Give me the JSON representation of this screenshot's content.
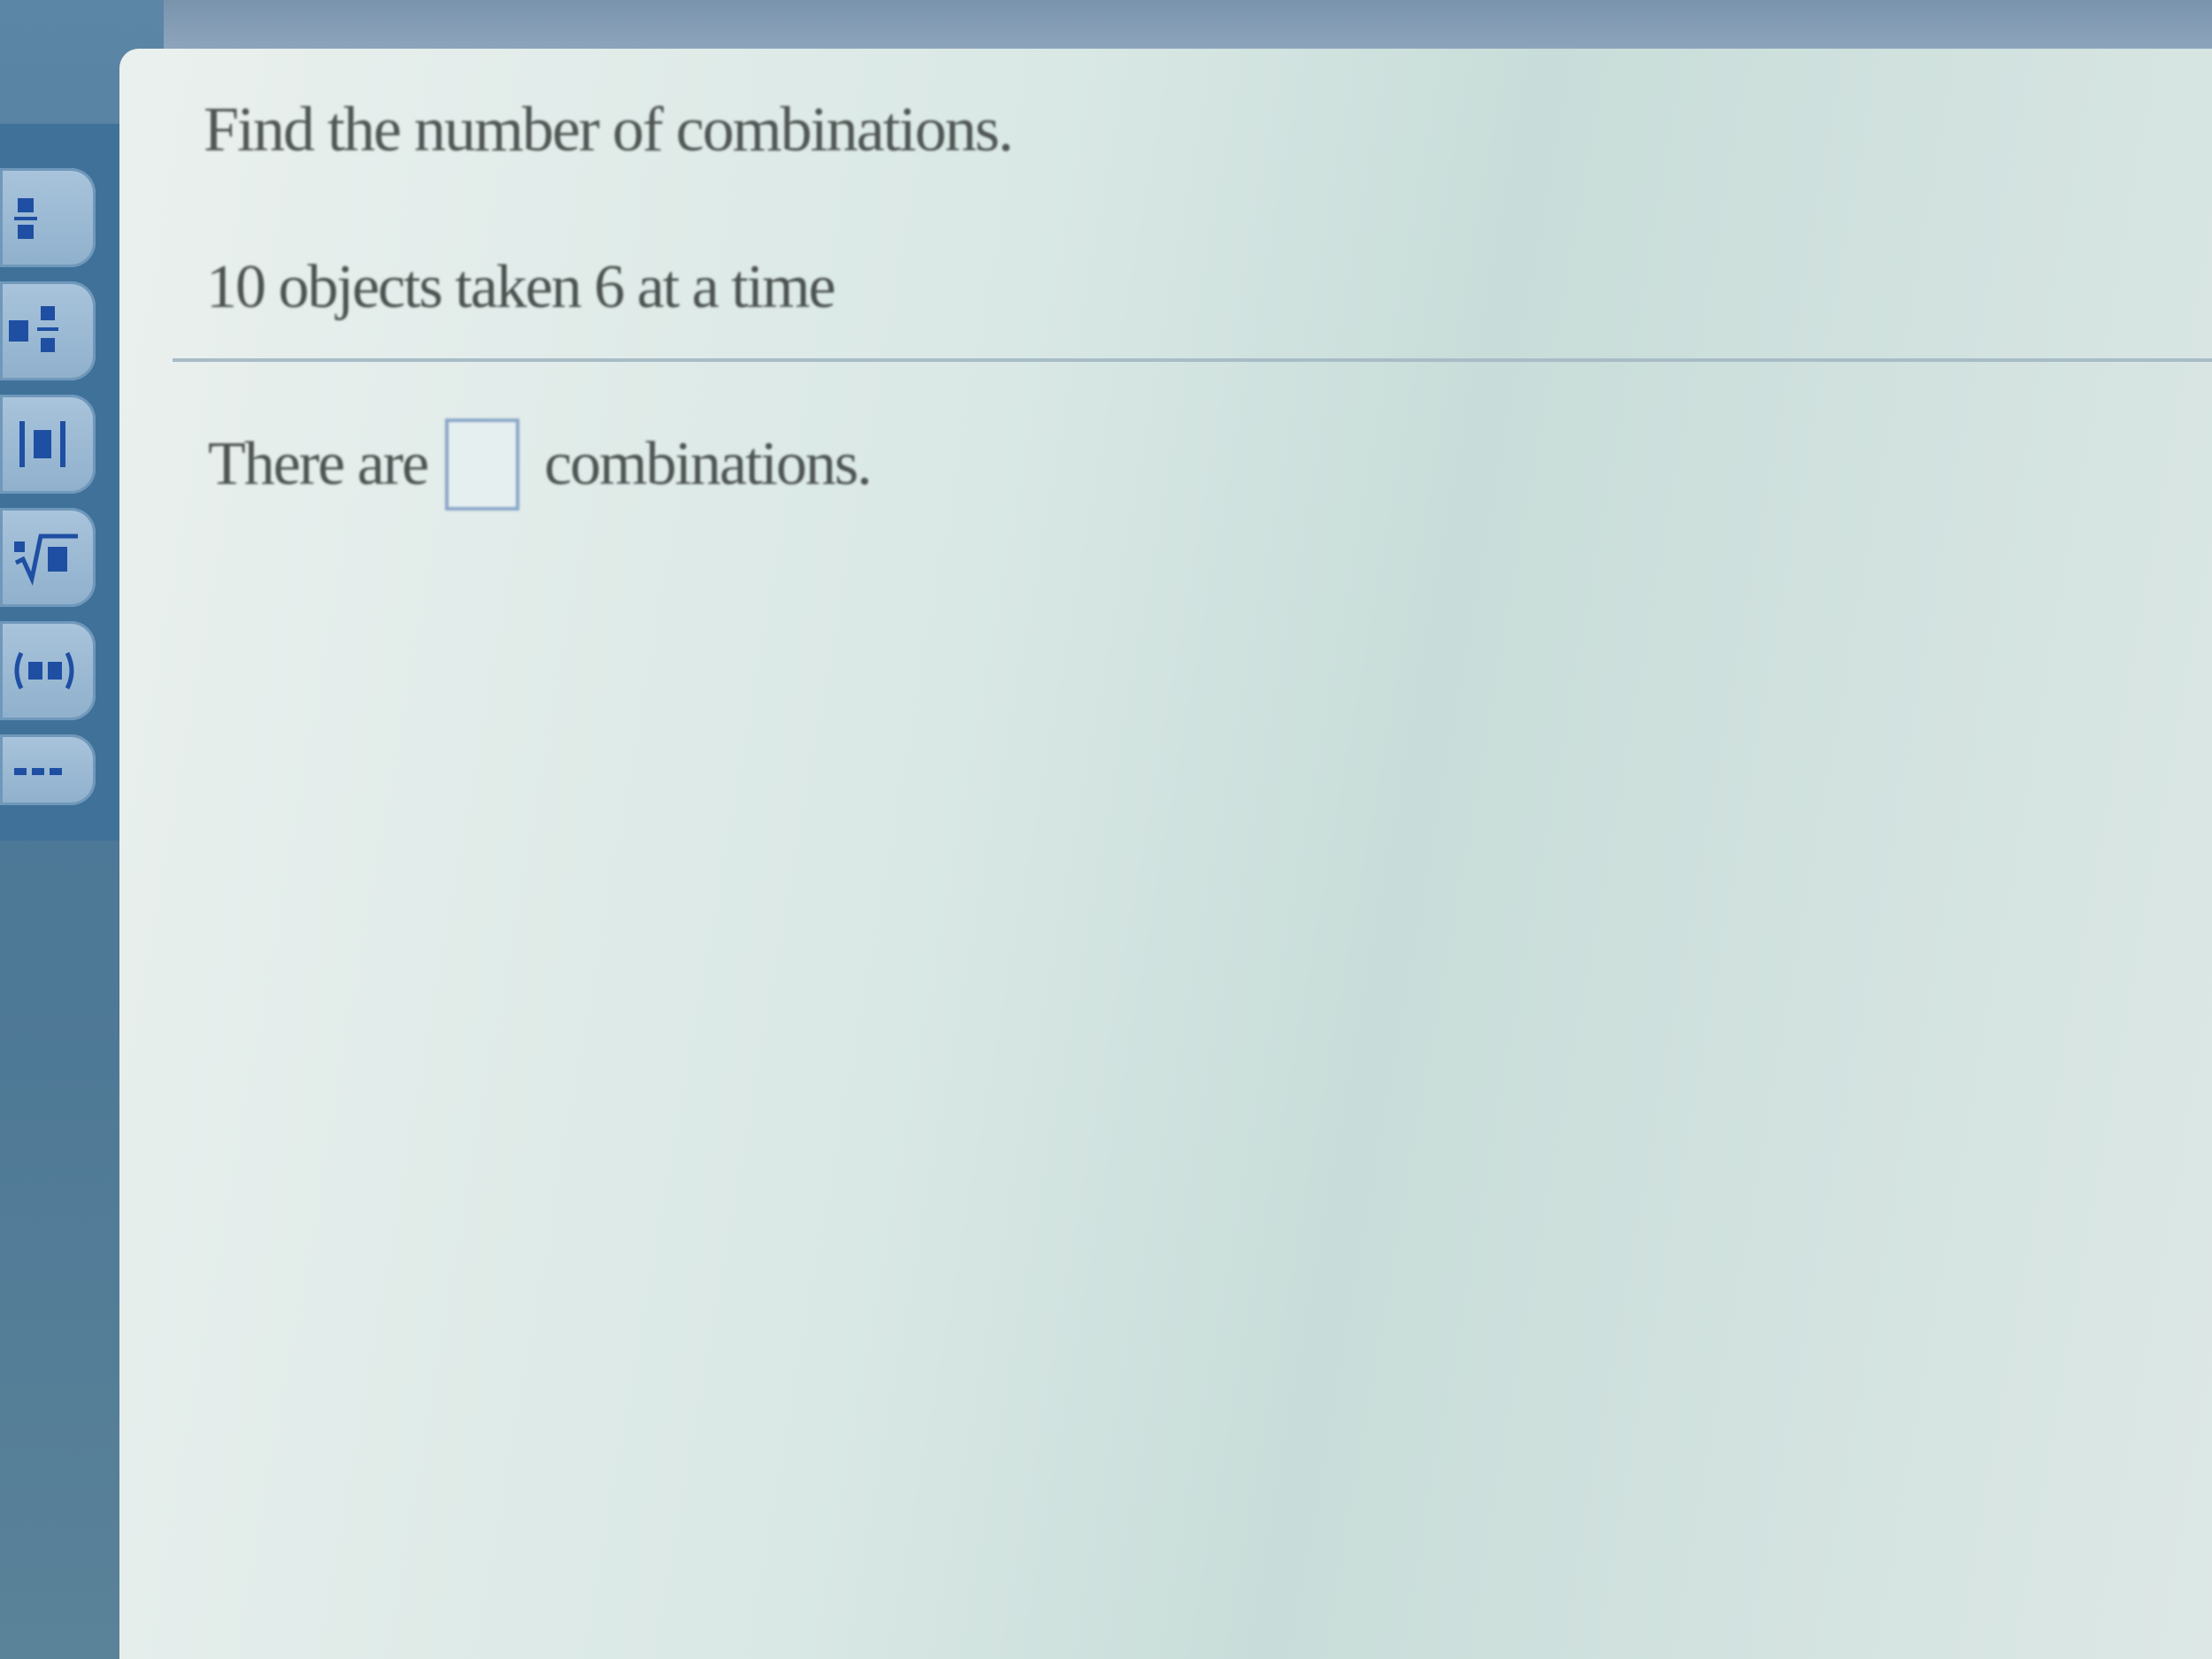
{
  "question": {
    "instruction": "Find the number of combinations.",
    "prompt": "10 objects taken 6 at a time"
  },
  "answer": {
    "prefix": "There are",
    "value": "",
    "suffix": "combinations."
  },
  "toolbar": {
    "icons": [
      "fraction-icon",
      "mixed-number-icon",
      "absolute-value-icon",
      "nth-root-icon",
      "decimal-icon",
      "more-icon"
    ]
  }
}
